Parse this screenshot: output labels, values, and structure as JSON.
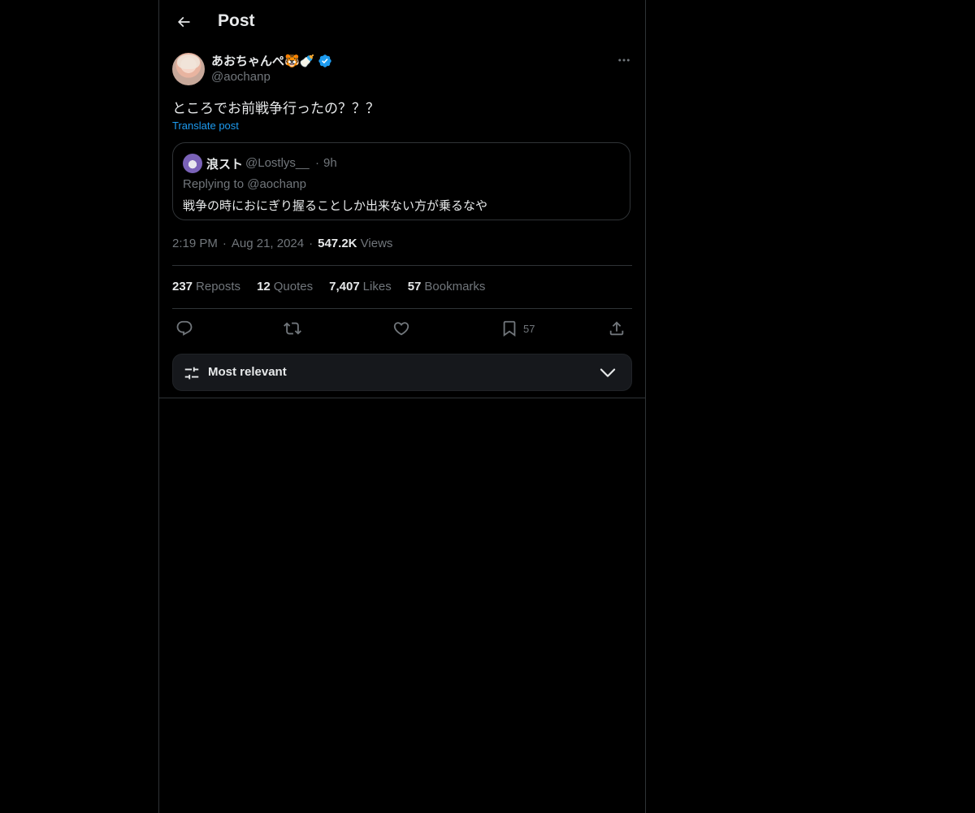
{
  "header": {
    "title": "Post",
    "back_icon": "arrow-left-icon"
  },
  "post": {
    "author": {
      "display_name": "あおちゃんぺ🐯🍼",
      "handle": "@aochanp",
      "verified": true,
      "verified_color": "#1d9bf0"
    },
    "text": "ところでお前戦争行ったの？？？",
    "translate_label": "Translate post",
    "quote": {
      "display_name": "浪スト",
      "handle": "@Lostlys__",
      "separator": "·",
      "time": "9h",
      "replying_to": "Replying to @aochanp",
      "text": "戦争の時におにぎり握ることしか出来ない方が乗るなや"
    },
    "meta": {
      "time": "2:19 PM",
      "separator": "·",
      "date": "Aug 21, 2024",
      "views_count": "547.2K",
      "views_label": "Views"
    },
    "stats": [
      {
        "count": "237",
        "label": "Reposts"
      },
      {
        "count": "12",
        "label": "Quotes"
      },
      {
        "count": "7,407",
        "label": "Likes"
      },
      {
        "count": "57",
        "label": "Bookmarks"
      }
    ],
    "actions": {
      "reply_icon": "reply-icon",
      "repost_icon": "repost-icon",
      "like_icon": "heart-icon",
      "bookmark_icon": "bookmark-icon",
      "bookmark_count": "57",
      "share_icon": "share-icon"
    }
  },
  "sort": {
    "label": "Most relevant",
    "icon": "sliders-icon",
    "chevron": "chevron-down-icon"
  },
  "colors": {
    "background": "#000000",
    "text_primary": "#e7e9ea",
    "text_secondary": "#71767b",
    "accent": "#1d9bf0",
    "border": "#2f3336"
  }
}
